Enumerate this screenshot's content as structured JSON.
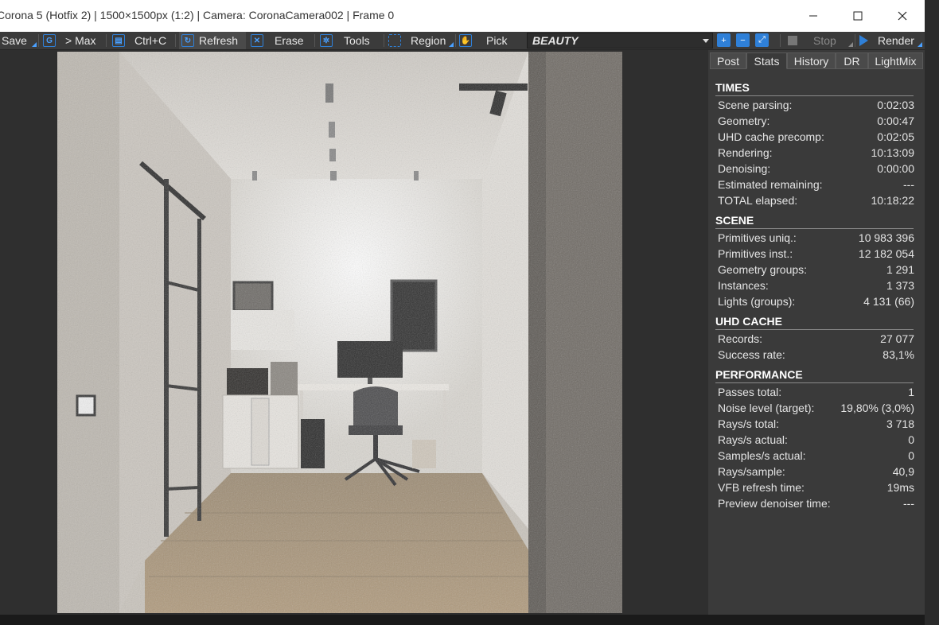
{
  "window": {
    "title": "Corona 5 (Hotfix 2) | 1500×1500px (1:2) | Camera: CoronaCamera002 | Frame 0",
    "controls": {
      "minimize": "—",
      "maximize": "☐",
      "close": "✕"
    }
  },
  "toolbar": {
    "save": "Save",
    "to_max": "> Max",
    "copy": "Ctrl+C",
    "refresh": "Refresh",
    "erase": "Erase",
    "tools": "Tools",
    "region": "Region",
    "pick": "Pick",
    "channel": "BEAUTY",
    "stop": "Stop",
    "render": "Render"
  },
  "tabs": [
    "Post",
    "Stats",
    "History",
    "DR",
    "LightMix"
  ],
  "active_tab": "Stats",
  "stats": {
    "times": {
      "heading": "TIMES",
      "rows": [
        {
          "label": "Scene parsing:",
          "value": "0:02:03"
        },
        {
          "label": "Geometry:",
          "value": "0:00:47"
        },
        {
          "label": "UHD cache precomp:",
          "value": "0:02:05"
        },
        {
          "label": "Rendering:",
          "value": "10:13:09"
        },
        {
          "label": "Denoising:",
          "value": "0:00:00"
        },
        {
          "label": "Estimated remaining:",
          "value": "---"
        },
        {
          "label": "TOTAL elapsed:",
          "value": "10:18:22"
        }
      ]
    },
    "scene": {
      "heading": "SCENE",
      "rows": [
        {
          "label": "Primitives uniq.:",
          "value": "10 983 396"
        },
        {
          "label": "Primitives inst.:",
          "value": "12 182 054"
        },
        {
          "label": "Geometry groups:",
          "value": "1 291"
        },
        {
          "label": "Instances:",
          "value": "1 373"
        },
        {
          "label": "Lights (groups):",
          "value": "4 131 (66)"
        }
      ]
    },
    "uhd_cache": {
      "heading": "UHD CACHE",
      "rows": [
        {
          "label": "Records:",
          "value": "27 077"
        },
        {
          "label": "Success rate:",
          "value": "83,1%"
        }
      ]
    },
    "performance": {
      "heading": "PERFORMANCE",
      "rows": [
        {
          "label": "Passes total:",
          "value": "1"
        },
        {
          "label": "Noise level (target):",
          "value": "19,80% (3,0%)"
        },
        {
          "label": "Rays/s total:",
          "value": "3 718"
        },
        {
          "label": "Rays/s actual:",
          "value": "0"
        },
        {
          "label": "Samples/s actual:",
          "value": "0"
        },
        {
          "label": "Rays/sample:",
          "value": "40,9"
        },
        {
          "label": "VFB refresh time:",
          "value": "19ms"
        },
        {
          "label": "Preview denoiser time:",
          "value": "---"
        }
      ]
    }
  },
  "colors": {
    "accent": "#2f80d8",
    "panel_bg": "#3a3a3a",
    "toolbar_bg": "#3b3b3b"
  }
}
